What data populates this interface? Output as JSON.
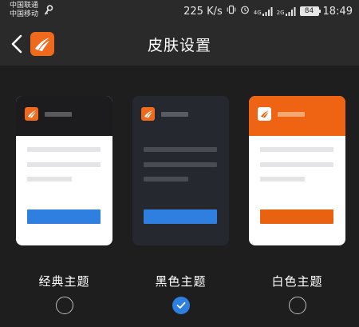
{
  "status_bar": {
    "carrier_1": "中国联通",
    "carrier_2": "中国移动",
    "net_speed": "225 K/s",
    "signal_1_tag": "4G",
    "signal_2_tag": "2G",
    "battery": "84",
    "time": "18:49"
  },
  "header": {
    "title": "皮肤设置"
  },
  "themes": [
    {
      "label": "经典主题",
      "selected": false
    },
    {
      "label": "黑色主题",
      "selected": true
    },
    {
      "label": "白色主题",
      "selected": false
    }
  ],
  "colors": {
    "accent_blue": "#2f7fe0",
    "brand_orange": "#f06a1e",
    "background": "#1e1e1e"
  },
  "icons": {
    "back": "chevron-left-icon",
    "logo": "app-logo-icon",
    "check": "check-icon"
  }
}
